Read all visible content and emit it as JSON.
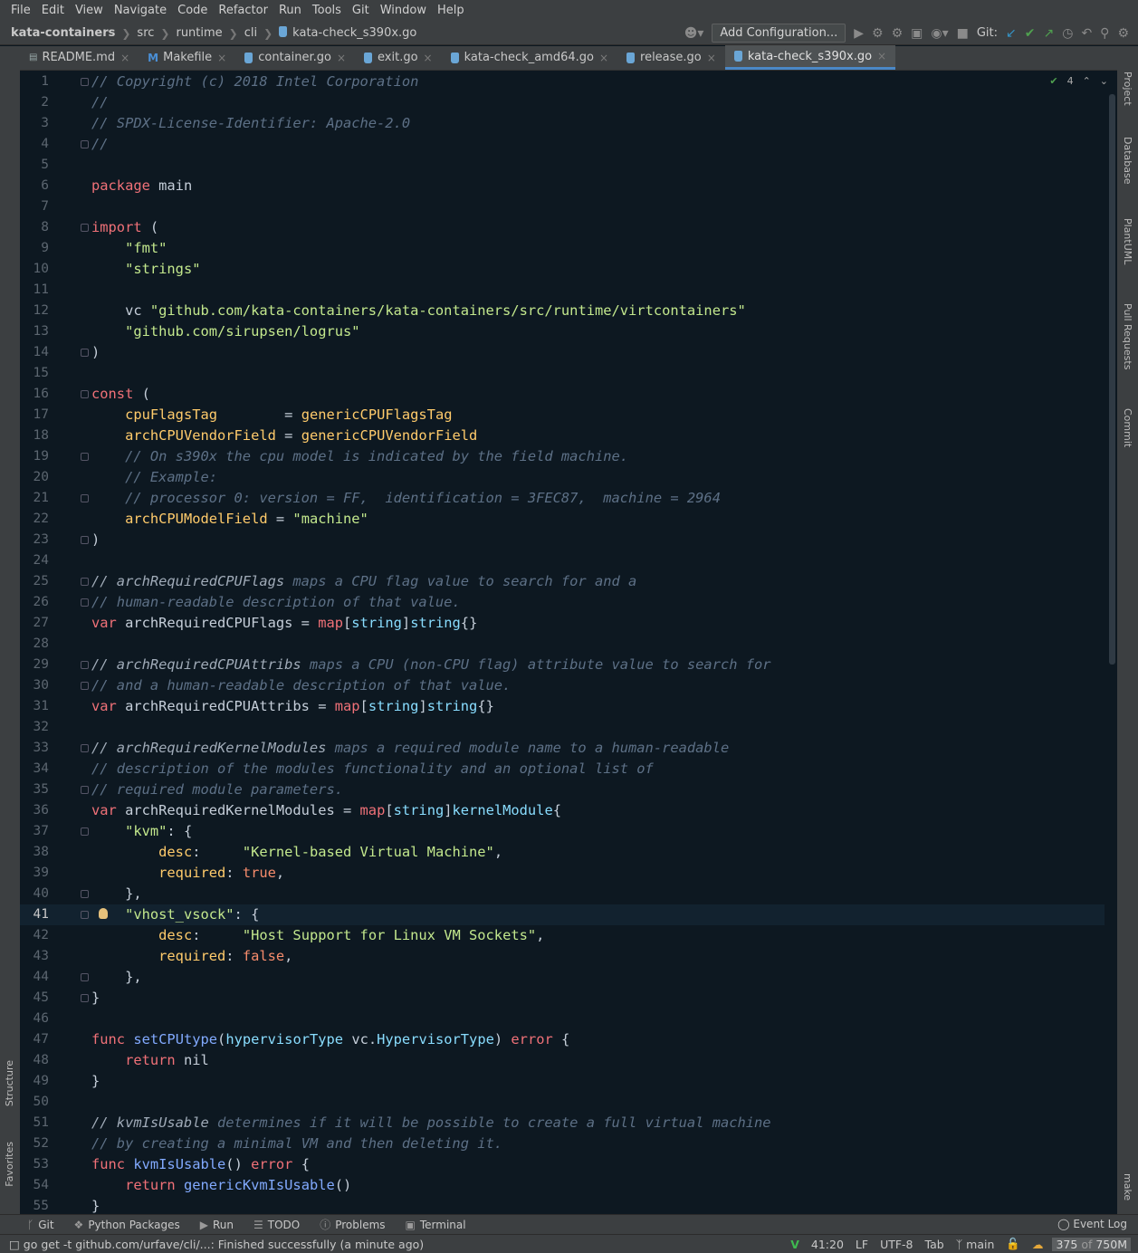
{
  "menu": [
    "File",
    "Edit",
    "View",
    "Navigate",
    "Code",
    "Refactor",
    "Run",
    "Tools",
    "Git",
    "Window",
    "Help"
  ],
  "breadcrumb": [
    "kata-containers",
    "src",
    "runtime",
    "cli",
    "kata-check_s390x.go"
  ],
  "toolbar": {
    "add_configuration": "Add Configuration...",
    "git_label": "Git:"
  },
  "tabs": [
    {
      "label": "README.md",
      "icon": "markdown-icon"
    },
    {
      "label": "Makefile",
      "icon": "makefile-icon"
    },
    {
      "label": "container.go",
      "icon": "go-file-icon"
    },
    {
      "label": "exit.go",
      "icon": "go-file-icon"
    },
    {
      "label": "kata-check_amd64.go",
      "icon": "go-file-icon"
    },
    {
      "label": "release.go",
      "icon": "go-file-icon"
    },
    {
      "label": "kata-check_s390x.go",
      "icon": "go-file-icon",
      "active": true
    }
  ],
  "editor": {
    "inspection_count": "4",
    "current_line": 41,
    "lines": [
      [
        [
          "cm",
          "// Copyright (c) 2018 Intel Corporation"
        ]
      ],
      [
        [
          "cm",
          "//"
        ]
      ],
      [
        [
          "cm",
          "// SPDX-License-Identifier: Apache-2.0"
        ]
      ],
      [
        [
          "cm",
          "//"
        ]
      ],
      [],
      [
        [
          "kw",
          "package"
        ],
        [
          "pl",
          " main"
        ]
      ],
      [],
      [
        [
          "kw",
          "import"
        ],
        [
          "pl",
          " ("
        ]
      ],
      [
        [
          "pl",
          "    "
        ],
        [
          "str",
          "\"fmt\""
        ]
      ],
      [
        [
          "pl",
          "    "
        ],
        [
          "str",
          "\"strings\""
        ]
      ],
      [],
      [
        [
          "pl",
          "    vc "
        ],
        [
          "str",
          "\"github.com/kata-containers/kata-containers/src/runtime/virtcontainers\""
        ]
      ],
      [
        [
          "pl",
          "    "
        ],
        [
          "str",
          "\"github.com/sirupsen/logrus\""
        ]
      ],
      [
        [
          "pl",
          ")"
        ]
      ],
      [],
      [
        [
          "kw",
          "const"
        ],
        [
          "pl",
          " ("
        ]
      ],
      [
        [
          "pl",
          "    "
        ],
        [
          "fld",
          "cpuFlagsTag"
        ],
        [
          "pl",
          "        = "
        ],
        [
          "fld",
          "genericCPUFlagsTag"
        ]
      ],
      [
        [
          "pl",
          "    "
        ],
        [
          "fld",
          "archCPUVendorField"
        ],
        [
          "pl",
          " = "
        ],
        [
          "fld",
          "genericCPUVendorField"
        ]
      ],
      [
        [
          "pl",
          "    "
        ],
        [
          "cm",
          "// On s390x the cpu model is indicated by the field machine."
        ]
      ],
      [
        [
          "pl",
          "    "
        ],
        [
          "cm",
          "// Example:"
        ]
      ],
      [
        [
          "pl",
          "    "
        ],
        [
          "cm",
          "// processor 0: version = FF,  identification = 3FEC87,  machine = 2964"
        ]
      ],
      [
        [
          "pl",
          "    "
        ],
        [
          "fld",
          "archCPUModelField"
        ],
        [
          "pl",
          " = "
        ],
        [
          "str",
          "\"machine\""
        ]
      ],
      [
        [
          "pl",
          ")"
        ]
      ],
      [],
      [
        [
          "cmb",
          "// archRequiredCPUFlags"
        ],
        [
          "cm",
          " maps a CPU flag value to search for and a"
        ]
      ],
      [
        [
          "cm",
          "// human-readable description of that value."
        ]
      ],
      [
        [
          "kw",
          "var"
        ],
        [
          "pl",
          " archRequiredCPUFlags = "
        ],
        [
          "kw",
          "map"
        ],
        [
          "pl",
          "["
        ],
        [
          "ty",
          "string"
        ],
        [
          "pl",
          "]"
        ],
        [
          "ty",
          "string"
        ],
        [
          "pl",
          "{}"
        ]
      ],
      [],
      [
        [
          "cmb",
          "// archRequiredCPUAttribs"
        ],
        [
          "cm",
          " maps a CPU (non-CPU flag) attribute value to search for"
        ]
      ],
      [
        [
          "cm",
          "// and a human-readable description of that value."
        ]
      ],
      [
        [
          "kw",
          "var"
        ],
        [
          "pl",
          " archRequiredCPUAttribs = "
        ],
        [
          "kw",
          "map"
        ],
        [
          "pl",
          "["
        ],
        [
          "ty",
          "string"
        ],
        [
          "pl",
          "]"
        ],
        [
          "ty",
          "string"
        ],
        [
          "pl",
          "{}"
        ]
      ],
      [],
      [
        [
          "cmb",
          "// archRequiredKernelModules"
        ],
        [
          "cm",
          " maps a required module name to a human-readable"
        ]
      ],
      [
        [
          "cm",
          "// description of the modules functionality and an optional list of"
        ]
      ],
      [
        [
          "cm",
          "// required module parameters."
        ]
      ],
      [
        [
          "kw",
          "var"
        ],
        [
          "pl",
          " archRequiredKernelModules = "
        ],
        [
          "kw",
          "map"
        ],
        [
          "pl",
          "["
        ],
        [
          "ty",
          "string"
        ],
        [
          "pl",
          "]"
        ],
        [
          "ty",
          "kernelModule"
        ],
        [
          "pl",
          "{"
        ]
      ],
      [
        [
          "pl",
          "    "
        ],
        [
          "str",
          "\"kvm\""
        ],
        [
          "pl",
          ": {"
        ]
      ],
      [
        [
          "pl",
          "        "
        ],
        [
          "fld",
          "desc"
        ],
        [
          "pl",
          ":     "
        ],
        [
          "str",
          "\"Kernel-based Virtual Machine\""
        ],
        [
          "pl",
          ","
        ]
      ],
      [
        [
          "pl",
          "        "
        ],
        [
          "fld",
          "required"
        ],
        [
          "pl",
          ": "
        ],
        [
          "cst",
          "true"
        ],
        [
          "pl",
          ","
        ]
      ],
      [
        [
          "pl",
          "    },"
        ]
      ],
      [
        [
          "pl",
          "    "
        ],
        [
          "str",
          "\"vhost_vsock\""
        ],
        [
          "pl",
          ": {"
        ]
      ],
      [
        [
          "pl",
          "        "
        ],
        [
          "fld",
          "desc"
        ],
        [
          "pl",
          ":     "
        ],
        [
          "str",
          "\"Host Support for Linux VM Sockets\""
        ],
        [
          "pl",
          ","
        ]
      ],
      [
        [
          "pl",
          "        "
        ],
        [
          "fld",
          "required"
        ],
        [
          "pl",
          ": "
        ],
        [
          "cst",
          "false"
        ],
        [
          "pl",
          ","
        ]
      ],
      [
        [
          "pl",
          "    },"
        ]
      ],
      [
        [
          "pl",
          "}"
        ]
      ],
      [],
      [
        [
          "kw",
          "func"
        ],
        [
          "pl",
          " "
        ],
        [
          "fn",
          "setCPUtype"
        ],
        [
          "pl",
          "("
        ],
        [
          "ty",
          "hypervisorType"
        ],
        [
          "pl",
          " vc."
        ],
        [
          "ty",
          "HypervisorType"
        ],
        [
          "pl",
          ") "
        ],
        [
          "kw",
          "error"
        ],
        [
          "pl",
          " {"
        ]
      ],
      [
        [
          "pl",
          "    "
        ],
        [
          "kw",
          "return"
        ],
        [
          "pl",
          " nil"
        ]
      ],
      [
        [
          "pl",
          "}"
        ]
      ],
      [],
      [
        [
          "cmb",
          "// kvmIsUsable"
        ],
        [
          "cm",
          " determines if it will be possible to create a full virtual machine"
        ]
      ],
      [
        [
          "cm",
          "// by creating a minimal VM and then deleting it."
        ]
      ],
      [
        [
          "kw",
          "func"
        ],
        [
          "pl",
          " "
        ],
        [
          "fn",
          "kvmIsUsable"
        ],
        [
          "pl",
          "() "
        ],
        [
          "kw",
          "error"
        ],
        [
          "pl",
          " {"
        ]
      ],
      [
        [
          "pl",
          "    "
        ],
        [
          "kw",
          "return"
        ],
        [
          "pl",
          " "
        ],
        [
          "fn",
          "genericKvmIsUsable"
        ],
        [
          "pl",
          "()"
        ]
      ],
      [
        [
          "pl",
          "}"
        ]
      ]
    ]
  },
  "left_tools": [
    "Structure",
    "Favorites"
  ],
  "right_tools": [
    "Project",
    "Database",
    "PlantUML",
    "Pull Requests",
    "Commit",
    "make"
  ],
  "tool_windows": [
    {
      "label": "Git",
      "icon": "git-icon"
    },
    {
      "label": "Python Packages",
      "icon": "layers-icon"
    },
    {
      "label": "Run",
      "icon": "play-icon"
    },
    {
      "label": "TODO",
      "icon": "list-icon"
    },
    {
      "label": "Problems",
      "icon": "info-icon"
    },
    {
      "label": "Terminal",
      "icon": "terminal-icon"
    }
  ],
  "event_log": "Event Log",
  "status": {
    "message": "go get -t github.com/urfave/cli/...: Finished successfully (a minute ago)",
    "position": "41:20",
    "line_sep": "LF",
    "encoding": "UTF-8",
    "indent": "Tab",
    "branch": "main",
    "memory_used": "375",
    "memory_of": " of ",
    "memory_total": "750M"
  },
  "colors": {
    "background": "#0d1821",
    "keyword": "#f07178",
    "string": "#c3e88d",
    "comment": "#5d7086",
    "accent": "#4a88c7"
  }
}
